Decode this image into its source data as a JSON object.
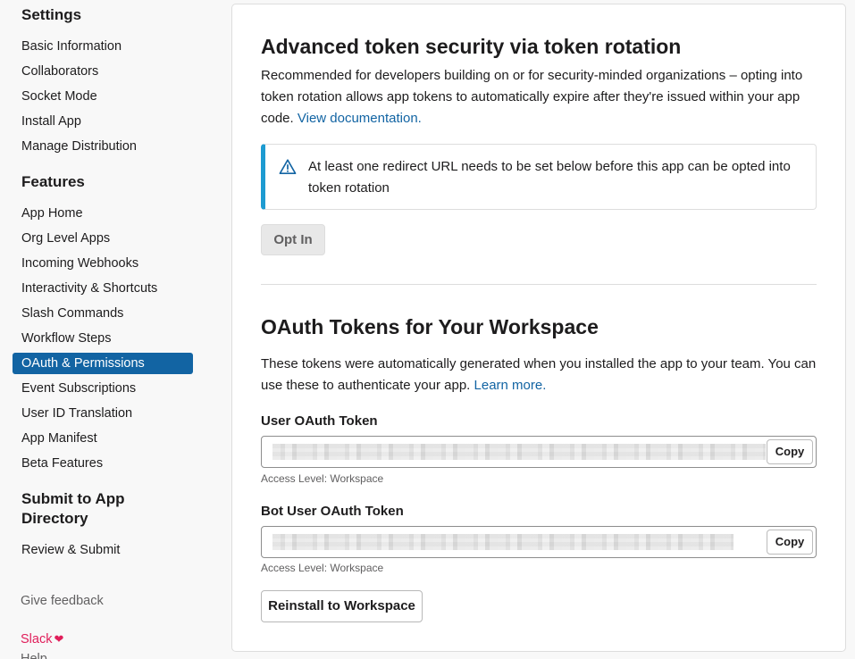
{
  "sidebar": {
    "settings_heading": "Settings",
    "settings_items": [
      {
        "label": "Basic Information"
      },
      {
        "label": "Collaborators"
      },
      {
        "label": "Socket Mode"
      },
      {
        "label": "Install App"
      },
      {
        "label": "Manage Distribution"
      }
    ],
    "features_heading": "Features",
    "features_items": [
      {
        "label": "App Home"
      },
      {
        "label": "Org Level Apps"
      },
      {
        "label": "Incoming Webhooks"
      },
      {
        "label": "Interactivity & Shortcuts"
      },
      {
        "label": "Slash Commands"
      },
      {
        "label": "Workflow Steps"
      },
      {
        "label": "OAuth & Permissions",
        "active": true
      },
      {
        "label": "Event Subscriptions"
      },
      {
        "label": "User ID Translation"
      },
      {
        "label": "App Manifest"
      },
      {
        "label": "Beta Features"
      }
    ],
    "submit_heading_line1": "Submit to App",
    "submit_heading_line2": "Directory",
    "submit_items": [
      {
        "label": "Review & Submit"
      }
    ],
    "feedback": "Give feedback",
    "slack": "Slack",
    "help": "Help"
  },
  "token_rotation": {
    "title": "Advanced token security via token rotation",
    "description": "Recommended for developers building on or for security-minded organizations – opting into token rotation allows app tokens to automatically expire after they're issued within your app code.",
    "doc_link": "View documentation.",
    "alert_text": "At least one redirect URL needs to be set below before this app can be opted into token rotation",
    "opt_in_label": "Opt In"
  },
  "oauth_tokens": {
    "title": "OAuth Tokens for Your Workspace",
    "description": "These tokens were automatically generated when you installed the app to your team. You can use these to authenticate your app.",
    "learn_more": "Learn more.",
    "user_token_label": "User OAuth Token",
    "user_token_hint": "Access Level: Workspace",
    "bot_token_label": "Bot User OAuth Token",
    "bot_token_hint": "Access Level: Workspace",
    "copy_label": "Copy",
    "reinstall_label": "Reinstall to Workspace"
  },
  "colors": {
    "accent": "#1264a3",
    "alert_border": "#1d9bd1",
    "slack_pink": "#e01e5a"
  },
  "icons": {
    "alert": "warning-triangle-icon",
    "slack_heart": "heart-icon"
  }
}
